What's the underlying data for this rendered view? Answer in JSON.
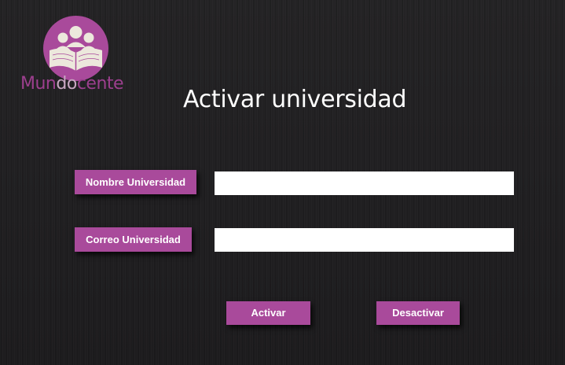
{
  "brand": {
    "logo_icon": "people-reading-book-icon",
    "name_part1": "Mun",
    "name_part2": "do",
    "name_part3": "cente",
    "colors": {
      "primary": "#a94a9b",
      "text_dark": "#9c3f8e",
      "text_light": "#c9a7c2",
      "book": "#ece8dc"
    }
  },
  "page": {
    "title": "Activar universidad"
  },
  "form": {
    "nombre": {
      "label": "Nombre Universidad",
      "value": "",
      "placeholder": ""
    },
    "correo": {
      "label": "Correo Universidad",
      "value": "",
      "placeholder": ""
    }
  },
  "actions": {
    "activar_label": "Activar",
    "desactivar_label": "Desactivar"
  }
}
